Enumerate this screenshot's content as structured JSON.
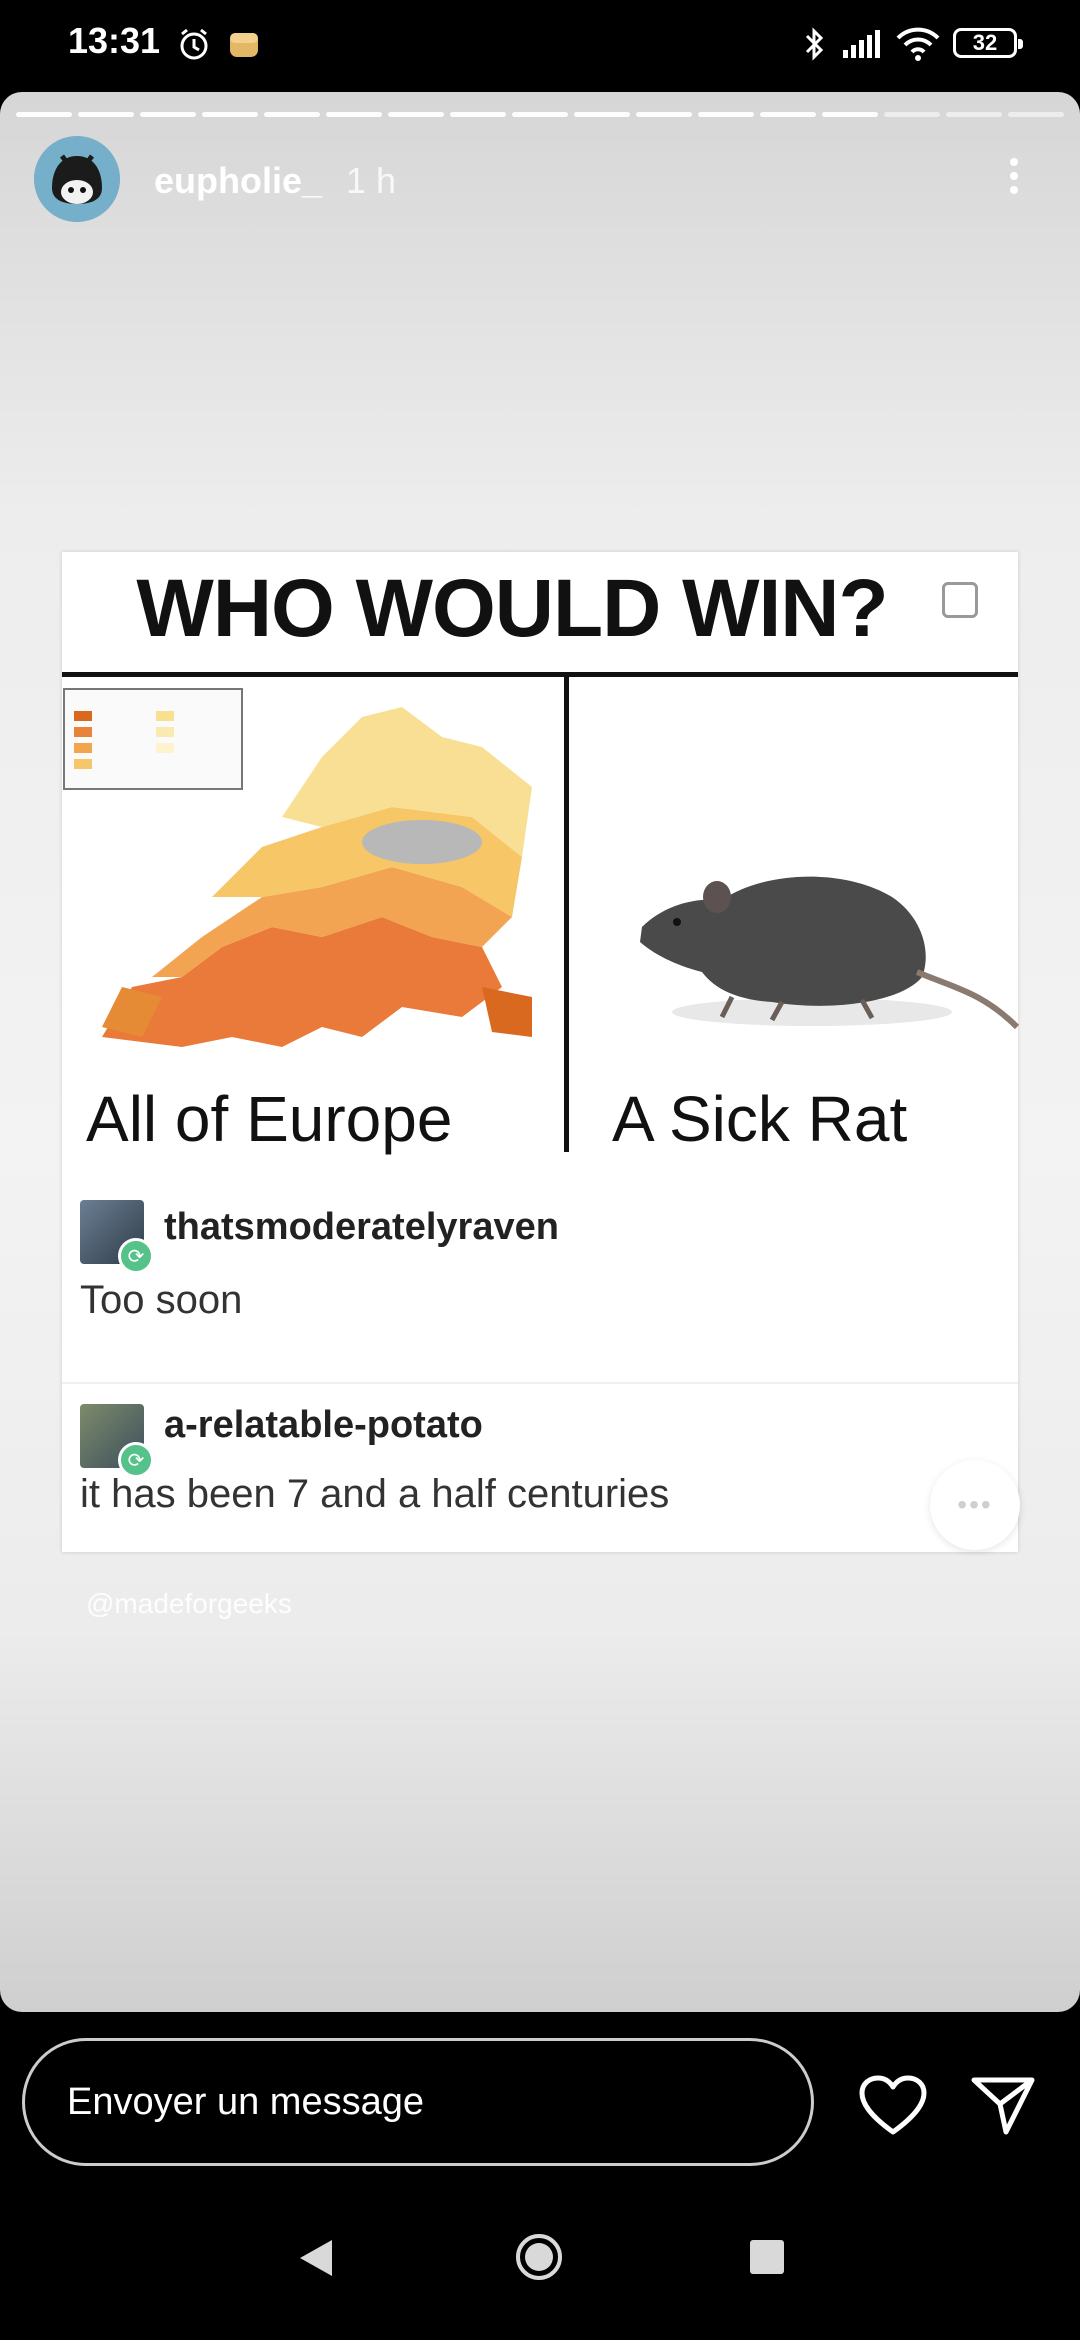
{
  "status_bar": {
    "time": "13:31",
    "battery_level": "32",
    "icons": [
      "alarm-icon",
      "app-notification-icon",
      "bluetooth-icon",
      "signal-icon",
      "wifi-icon",
      "battery-icon"
    ]
  },
  "story": {
    "progress": {
      "segments_total": 17,
      "segments_done": 14
    },
    "header": {
      "username": "eupholie_",
      "time_ago": "1 h",
      "more_icon": "more-vertical-icon"
    },
    "meme": {
      "title": "WHO WOULD WIN?",
      "left_caption": "All of Europe",
      "right_caption": "A Sick Rat",
      "comments": [
        {
          "username": "thatsmoderatelyraven",
          "text": "Too soon"
        },
        {
          "username": "a-relatable-potato",
          "text": "it has been 7 and a half centuries"
        }
      ]
    },
    "watermark": "@madeforgeeks"
  },
  "message_bar": {
    "placeholder": "Envoyer un message",
    "like_icon": "heart-icon",
    "send_icon": "send-icon"
  },
  "nav_bar": {
    "icons": [
      "back-icon",
      "home-icon",
      "recents-icon"
    ]
  },
  "colors": {
    "background": "#000000",
    "story_bg": "#efefef",
    "reblog_green": "#55c28a"
  }
}
